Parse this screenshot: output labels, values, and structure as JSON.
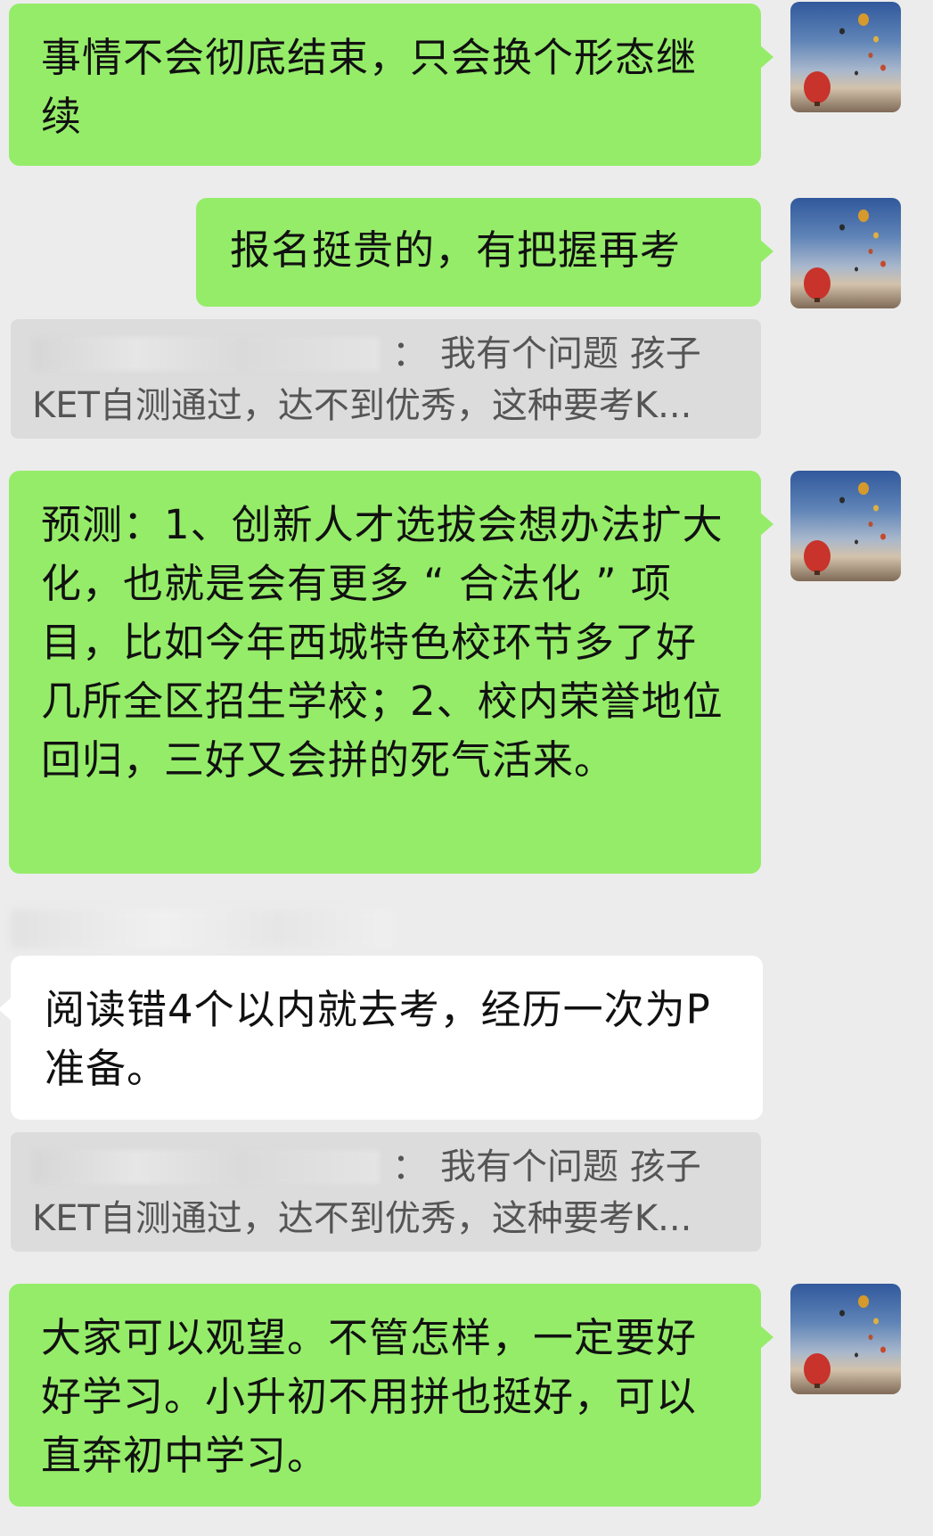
{
  "messages": [
    {
      "text": "事情不会彻底结束，只会换个形态继续"
    },
    {
      "text": "报名挺贵的，有把握再考"
    },
    {
      "line1": "我有个问题 孩子",
      "line2": "KET自测通过，达不到优秀，这种要考K..."
    },
    {
      "text": "预测：1、创新人才选拔会想办法扩大化，也就是会有更多 “ 合法化 ” 项目，比如今年西城特色校环节多了好几所全区招生学校；2、校内荣誉地位回归，三好又会拼的死气活来。"
    },
    {
      "text": "阅读错4个以内就去考，经历一次为P准备。"
    },
    {
      "line1": "我有个问题 孩子",
      "line2": "KET自测通过，达不到优秀，这种要考K..."
    },
    {
      "text": "大家可以观望。不管怎样，一定要好好学习。小升初不用拼也挺好，可以直奔初中学习。"
    }
  ],
  "quote_colon": "：",
  "colors": {
    "background": "#ececec",
    "my_bubble": "#95ec69",
    "their_bubble": "#ffffff",
    "quote_bg": "#dcdcdc"
  },
  "avatar_icon": "hot-air-balloon-icon"
}
